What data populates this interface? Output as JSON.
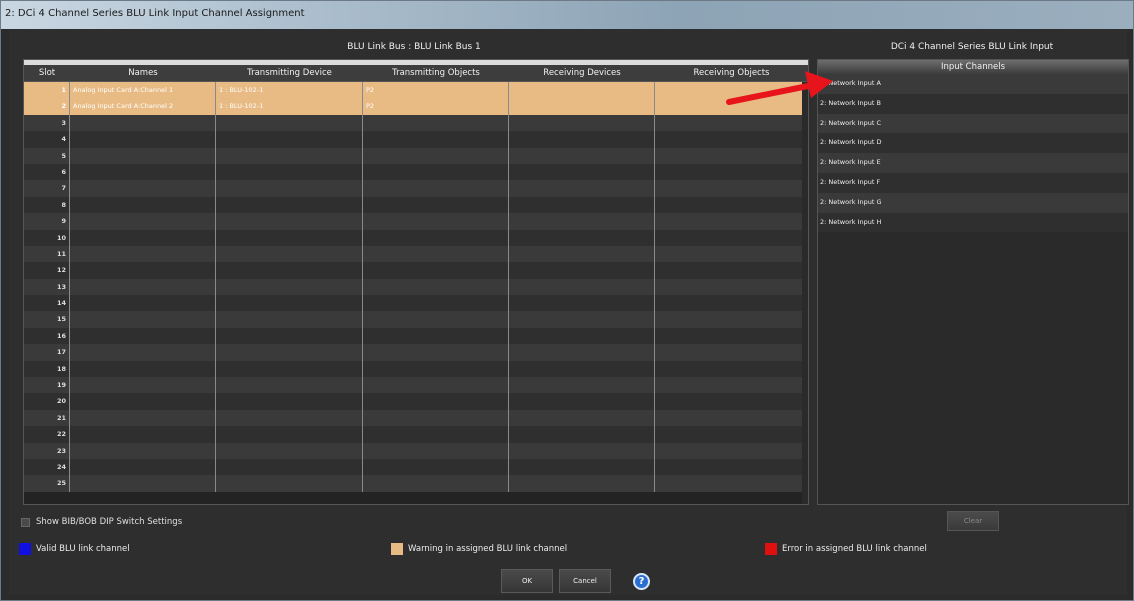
{
  "window": {
    "title": "2: DCi 4 Channel Series BLU Link Input Channel Assignment"
  },
  "bus_header": "BLU Link Bus : BLU Link Bus 1",
  "device_header": "DCi 4 Channel Series  BLU Link Input",
  "table": {
    "columns": [
      "Slot",
      "Names",
      "Transmitting Device",
      "Transmitting Objects",
      "Receiving Devices",
      "Receiving Objects"
    ],
    "rows": [
      {
        "slot": "1",
        "name": "Analog Input Card A:Channel 1",
        "tx_device": "1 : BLU-102-1",
        "tx_objects": "P2",
        "rx_devices": "",
        "rx_objects": "",
        "assigned": true
      },
      {
        "slot": "2",
        "name": "Analog Input Card A:Channel 2",
        "tx_device": "1 : BLU-102-1",
        "tx_objects": "P2",
        "rx_devices": "",
        "rx_objects": "",
        "assigned": true
      },
      {
        "slot": "3",
        "name": "",
        "tx_device": "",
        "tx_objects": "",
        "rx_devices": "",
        "rx_objects": ""
      },
      {
        "slot": "4",
        "name": "",
        "tx_device": "",
        "tx_objects": "",
        "rx_devices": "",
        "rx_objects": ""
      },
      {
        "slot": "5",
        "name": "",
        "tx_device": "",
        "tx_objects": "",
        "rx_devices": "",
        "rx_objects": ""
      },
      {
        "slot": "6",
        "name": "",
        "tx_device": "",
        "tx_objects": "",
        "rx_devices": "",
        "rx_objects": ""
      },
      {
        "slot": "7",
        "name": "",
        "tx_device": "",
        "tx_objects": "",
        "rx_devices": "",
        "rx_objects": ""
      },
      {
        "slot": "8",
        "name": "",
        "tx_device": "",
        "tx_objects": "",
        "rx_devices": "",
        "rx_objects": ""
      },
      {
        "slot": "9",
        "name": "",
        "tx_device": "",
        "tx_objects": "",
        "rx_devices": "",
        "rx_objects": ""
      },
      {
        "slot": "10",
        "name": "",
        "tx_device": "",
        "tx_objects": "",
        "rx_devices": "",
        "rx_objects": ""
      },
      {
        "slot": "11",
        "name": "",
        "tx_device": "",
        "tx_objects": "",
        "rx_devices": "",
        "rx_objects": ""
      },
      {
        "slot": "12",
        "name": "",
        "tx_device": "",
        "tx_objects": "",
        "rx_devices": "",
        "rx_objects": ""
      },
      {
        "slot": "13",
        "name": "",
        "tx_device": "",
        "tx_objects": "",
        "rx_devices": "",
        "rx_objects": ""
      },
      {
        "slot": "14",
        "name": "",
        "tx_device": "",
        "tx_objects": "",
        "rx_devices": "",
        "rx_objects": ""
      },
      {
        "slot": "15",
        "name": "",
        "tx_device": "",
        "tx_objects": "",
        "rx_devices": "",
        "rx_objects": ""
      },
      {
        "slot": "16",
        "name": "",
        "tx_device": "",
        "tx_objects": "",
        "rx_devices": "",
        "rx_objects": ""
      },
      {
        "slot": "17",
        "name": "",
        "tx_device": "",
        "tx_objects": "",
        "rx_devices": "",
        "rx_objects": ""
      },
      {
        "slot": "18",
        "name": "",
        "tx_device": "",
        "tx_objects": "",
        "rx_devices": "",
        "rx_objects": ""
      },
      {
        "slot": "19",
        "name": "",
        "tx_device": "",
        "tx_objects": "",
        "rx_devices": "",
        "rx_objects": ""
      },
      {
        "slot": "20",
        "name": "",
        "tx_device": "",
        "tx_objects": "",
        "rx_devices": "",
        "rx_objects": ""
      },
      {
        "slot": "21",
        "name": "",
        "tx_device": "",
        "tx_objects": "",
        "rx_devices": "",
        "rx_objects": ""
      },
      {
        "slot": "22",
        "name": "",
        "tx_device": "",
        "tx_objects": "",
        "rx_devices": "",
        "rx_objects": ""
      },
      {
        "slot": "23",
        "name": "",
        "tx_device": "",
        "tx_objects": "",
        "rx_devices": "",
        "rx_objects": ""
      },
      {
        "slot": "24",
        "name": "",
        "tx_device": "",
        "tx_objects": "",
        "rx_devices": "",
        "rx_objects": ""
      },
      {
        "slot": "25",
        "name": "",
        "tx_device": "",
        "tx_objects": "",
        "rx_devices": "",
        "rx_objects": ""
      }
    ]
  },
  "input_channels": {
    "header": "Input Channels",
    "items": [
      "2: Network Input A",
      "2: Network Input B",
      "2: Network Input C",
      "2: Network Input D",
      "2: Network Input E",
      "2: Network Input F",
      "2: Network Input G",
      "2: Network Input H"
    ]
  },
  "show_dip_label": "Show BIB/BOB DIP Switch Settings",
  "clear_label": "Clear",
  "legend": [
    {
      "label": "Valid BLU link channel",
      "color": "#1010e0"
    },
    {
      "label": "Warning in assigned BLU link channel",
      "color": "#e8bb84"
    },
    {
      "label": "Error in assigned BLU link channel",
      "color": "#e01010"
    }
  ],
  "ok_label": "OK",
  "cancel_label": "Cancel",
  "help_icon": "help-icon",
  "annotation_color": "#e8141c"
}
